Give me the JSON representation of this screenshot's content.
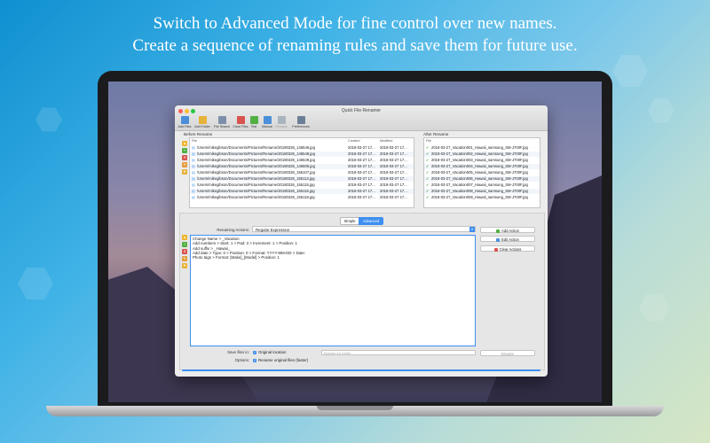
{
  "headline": {
    "line1": "Switch to Advanced Mode for fine control over new names.",
    "line2": "Create a sequence of renaming rules and save them for future use."
  },
  "window": {
    "title": "Quick File Renamer",
    "toolbar": [
      {
        "label": "Add Files",
        "icon": "add-files-icon",
        "color": "#4a8fd8",
        "enabled": true
      },
      {
        "label": "Add Folder",
        "icon": "add-folder-icon",
        "color": "#e7b23a",
        "enabled": true
      },
      {
        "label": "File Search",
        "icon": "search-icon",
        "color": "#7c8fa8",
        "enabled": true
      },
      {
        "label": "Clear Files",
        "icon": "clear-files-icon",
        "color": "#d9534f",
        "enabled": true
      },
      {
        "label": "Test",
        "icon": "test-check-icon",
        "color": "#52b043",
        "enabled": true
      },
      {
        "label": "Manual",
        "icon": "manual-icon",
        "color": "#4a8fd8",
        "enabled": true
      },
      {
        "label": "Rename",
        "icon": "rename-icon",
        "color": "#aab4c0",
        "enabled": false
      },
      {
        "label": "Preferences",
        "icon": "preferences-icon",
        "color": "#6d7f96",
        "enabled": true
      }
    ]
  },
  "before": {
    "label": "Before Rename",
    "columns": {
      "file": "File",
      "created": "Created",
      "modified": "Modified"
    },
    "rows": [
      {
        "file": "/Users/mikegibson/Documents/Pictures/Rename/20180326_145546.jpg",
        "created": "2018-03-27 17...",
        "modified": "2018-03-27 17..."
      },
      {
        "file": "/Users/mikegibson/Documents/Pictures/Rename/20180326_145548.jpg",
        "created": "2018-03-27 17...",
        "modified": "2018-03-27 17..."
      },
      {
        "file": "/Users/mikegibson/Documents/Pictures/Rename/20180326_145549.jpg",
        "created": "2018-03-27 17...",
        "modified": "2018-03-27 17..."
      },
      {
        "file": "/Users/mikegibson/Documents/Pictures/Rename/20180326_145605.jpg",
        "created": "2018-03-27 17...",
        "modified": "2018-03-27 17..."
      },
      {
        "file": "/Users/mikegibson/Documents/Pictures/Rename/20180326_155107.jpg",
        "created": "2018-03-27 17...",
        "modified": "2018-03-27 17..."
      },
      {
        "file": "/Users/mikegibson/Documents/Pictures/Rename/20180326_155113.jpg",
        "created": "2018-03-27 17...",
        "modified": "2018-03-27 17..."
      },
      {
        "file": "/Users/mikegibson/Documents/Pictures/Rename/20180326_155115.jpg",
        "created": "2018-03-27 17...",
        "modified": "2018-03-27 17..."
      },
      {
        "file": "/Users/mikegibson/Documents/Pictures/Rename/20180326_155116.jpg",
        "created": "2018-03-27 17...",
        "modified": "2018-03-27 17..."
      },
      {
        "file": "/Users/mikegibson/Documents/Pictures/Rename/20180326_155118.jpg",
        "created": "2018-03-27 17...",
        "modified": "2018-03-27 17..."
      }
    ]
  },
  "after": {
    "label": "After Rename",
    "column": "File",
    "rows": [
      "2018-03-27_Vacation001_Hawaii_samsung_SM-J700F.jpg",
      "2018-03-27_Vacation002_Hawaii_samsung_SM-J700F.jpg",
      "2018-03-27_Vacation003_Hawaii_samsung_SM-J700F.jpg",
      "2018-03-27_Vacation004_Hawaii_samsung_SM-J700F.jpg",
      "2018-03-27_Vacation005_Hawaii_samsung_SM-J700F.jpg",
      "2018-03-27_Vacation006_Hawaii_samsung_SM-J700F.jpg",
      "2018-03-27_Vacation007_Hawaii_samsung_SM-J700F.jpg",
      "2018-03-27_Vacation008_Hawaii_samsung_SM-J700F.jpg",
      "2018-03-27_Vacation009_Hawaii_samsung_SM-J700F.jpg"
    ]
  },
  "mode": {
    "simple": "Simple",
    "advanced": "Advanced",
    "selected": "Advanced"
  },
  "renaming": {
    "label": "Renaming Actions:",
    "selected": "Regular Expression",
    "buttons": {
      "add": "Add Action",
      "edit": "Edit Action",
      "clear": "Clear Actions"
    },
    "rules": [
      "Change Name > _Vacation",
      "Add numbers > Start: 1 > Pad: 3 > Increment: 1 > Position: 1",
      "Add suffix > _Hawaii_",
      "Add date > Type: 0 > Position: 0 > Format: YYYY-MM-DD > Date:",
      "Photo tags > Format: [Make]_[Model] > Position: 1"
    ]
  },
  "save": {
    "label": "Save files in:",
    "original_location": "Original location",
    "folder_placeholder": "Browse for folder",
    "browse": "Browse"
  },
  "options": {
    "label": "Options:",
    "rename_original": "Rename original files (faster)"
  },
  "colors": {
    "accent": "#3d8ef0",
    "check": "#2fa12f"
  }
}
